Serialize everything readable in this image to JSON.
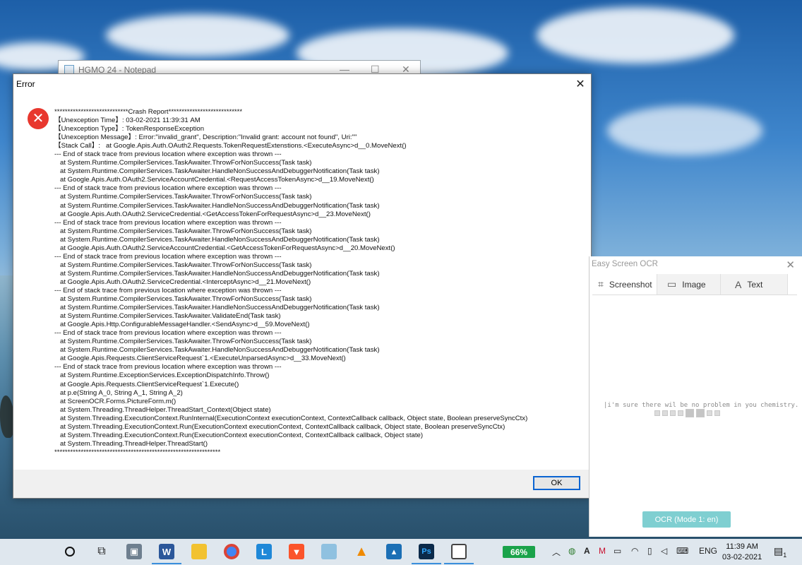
{
  "notepad": {
    "title": "HGMO 24 - Notepad",
    "minimize_glyph": "—",
    "maximize_glyph": "☐",
    "close_glyph": "✕"
  },
  "error_dialog": {
    "title": "Error",
    "close_glyph": "✕",
    "icon": "error-x-icon",
    "icon_glyph": "✕",
    "ok_label": "OK",
    "report_lines": [
      "****************************Crash Report****************************",
      "【Unexception Time】: 03-02-2021 11:39:31 AM",
      "【Unexception Type】: TokenResponseException",
      "【Unexception Message】: Error:\"invalid_grant\", Description:\"Invalid grant: account not found\", Uri:\"\"",
      "【Stack Call】:   at Google.Apis.Auth.OAuth2.Requests.TokenRequestExtenstions.<ExecuteAsync>d__0.MoveNext()",
      "--- End of stack trace from previous location where exception was thrown ---",
      "   at System.Runtime.CompilerServices.TaskAwaiter.ThrowForNonSuccess(Task task)",
      "   at System.Runtime.CompilerServices.TaskAwaiter.HandleNonSuccessAndDebuggerNotification(Task task)",
      "   at Google.Apis.Auth.OAuth2.ServiceAccountCredential.<RequestAccessTokenAsync>d__19.MoveNext()",
      "--- End of stack trace from previous location where exception was thrown ---",
      "   at System.Runtime.CompilerServices.TaskAwaiter.ThrowForNonSuccess(Task task)",
      "   at System.Runtime.CompilerServices.TaskAwaiter.HandleNonSuccessAndDebuggerNotification(Task task)",
      "   at Google.Apis.Auth.OAuth2.ServiceCredential.<GetAccessTokenForRequestAsync>d__23.MoveNext()",
      "--- End of stack trace from previous location where exception was thrown ---",
      "   at System.Runtime.CompilerServices.TaskAwaiter.ThrowForNonSuccess(Task task)",
      "   at System.Runtime.CompilerServices.TaskAwaiter.HandleNonSuccessAndDebuggerNotification(Task task)",
      "   at Google.Apis.Auth.OAuth2.ServiceAccountCredential.<GetAccessTokenForRequestAsync>d__20.MoveNext()",
      "--- End of stack trace from previous location where exception was thrown ---",
      "   at System.Runtime.CompilerServices.TaskAwaiter.ThrowForNonSuccess(Task task)",
      "   at System.Runtime.CompilerServices.TaskAwaiter.HandleNonSuccessAndDebuggerNotification(Task task)",
      "   at Google.Apis.Auth.OAuth2.ServiceCredential.<InterceptAsync>d__21.MoveNext()",
      "--- End of stack trace from previous location where exception was thrown ---",
      "   at System.Runtime.CompilerServices.TaskAwaiter.ThrowForNonSuccess(Task task)",
      "   at System.Runtime.CompilerServices.TaskAwaiter.HandleNonSuccessAndDebuggerNotification(Task task)",
      "   at System.Runtime.CompilerServices.TaskAwaiter.ValidateEnd(Task task)",
      "   at Google.Apis.Http.ConfigurableMessageHandler.<SendAsync>d__59.MoveNext()",
      "--- End of stack trace from previous location where exception was thrown ---",
      "   at System.Runtime.CompilerServices.TaskAwaiter.ThrowForNonSuccess(Task task)",
      "   at System.Runtime.CompilerServices.TaskAwaiter.HandleNonSuccessAndDebuggerNotification(Task task)",
      "   at Google.Apis.Requests.ClientServiceRequest`1.<ExecuteUnparsedAsync>d__33.MoveNext()",
      "--- End of stack trace from previous location where exception was thrown ---",
      "   at System.Runtime.ExceptionServices.ExceptionDispatchInfo.Throw()",
      "   at Google.Apis.Requests.ClientServiceRequest`1.Execute()",
      "   at p.e(String A_0, String A_1, String A_2)",
      "   at ScreenOCR.Forms.PictureForm.m()",
      "   at System.Threading.ThreadHelper.ThreadStart_Context(Object state)",
      "   at System.Threading.ExecutionContext.RunInternal(ExecutionContext executionContext, ContextCallback callback, Object state, Boolean preserveSyncCtx)",
      "   at System.Threading.ExecutionContext.Run(ExecutionContext executionContext, ContextCallback callback, Object state, Boolean preserveSyncCtx)",
      "   at System.Threading.ExecutionContext.Run(ExecutionContext executionContext, ContextCallback callback, Object state)",
      "   at System.Threading.ThreadHelper.ThreadStart()",
      "***************************************************************"
    ]
  },
  "ocr_window": {
    "title": "Easy Screen OCR",
    "close_glyph": "✕",
    "tabs": [
      {
        "label": "Screenshot",
        "icon": "crop-icon",
        "glyph": "⌗"
      },
      {
        "label": "Image",
        "icon": "image-icon",
        "glyph": "▭"
      },
      {
        "label": "Text",
        "icon": "text-icon",
        "glyph": "A"
      }
    ],
    "preview_text": "|i'm sure there wil be no problem in you chemistry.",
    "ocr_button": "OCR (Mode 1: en)"
  },
  "taskbar": {
    "battery_percent": "66%",
    "language": "ENG",
    "time": "11:39 AM",
    "date": "03-02-2021",
    "notification_count": "1",
    "accent_color": "#3a8fdc"
  }
}
